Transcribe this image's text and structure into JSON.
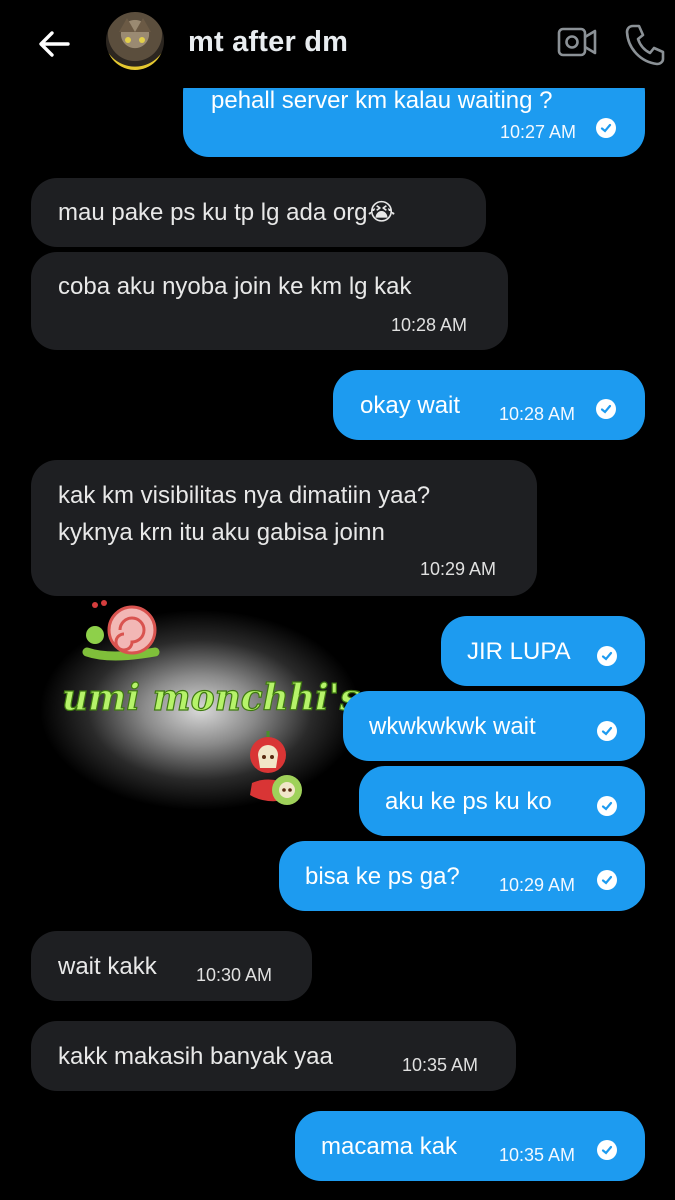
{
  "header": {
    "title": "mt after dm",
    "icons": [
      "back-arrow-icon",
      "video-call-icon",
      "phone-call-icon"
    ]
  },
  "colors": {
    "outgoing": "#1d9bf0",
    "incoming": "#1e1f22",
    "background": "#000000"
  },
  "sticker": {
    "text": "umi monchhi's"
  },
  "messages": [
    {
      "dir": "out",
      "text": "pehall server km kalau waiting ?",
      "time": "10:27 AM"
    },
    {
      "dir": "in",
      "text": "mau pake ps ku tp lg ada org😭",
      "time": ""
    },
    {
      "dir": "in",
      "text": "coba aku nyoba join ke km lg kak",
      "time": "10:28 AM"
    },
    {
      "dir": "out",
      "text": "okay wait",
      "time": "10:28 AM"
    },
    {
      "dir": "in",
      "text": "kak km visibilitas nya dimatiin yaa?",
      "text2": "kyknya krn itu aku gabisa joinn",
      "time": "10:29 AM"
    },
    {
      "dir": "out",
      "text": "JIR LUPA",
      "time": ""
    },
    {
      "dir": "out",
      "text": "wkwkwkwk wait",
      "time": ""
    },
    {
      "dir": "out",
      "text": "aku ke ps ku ko",
      "time": ""
    },
    {
      "dir": "out",
      "text": "bisa ke ps ga?",
      "time": "10:29 AM"
    },
    {
      "dir": "in",
      "text": "wait kakk",
      "time": "10:30 AM"
    },
    {
      "dir": "in",
      "text": "kakk makasih banyak yaa",
      "time": "10:35 AM"
    },
    {
      "dir": "out",
      "text": "macama kak",
      "time": "10:35 AM"
    }
  ]
}
